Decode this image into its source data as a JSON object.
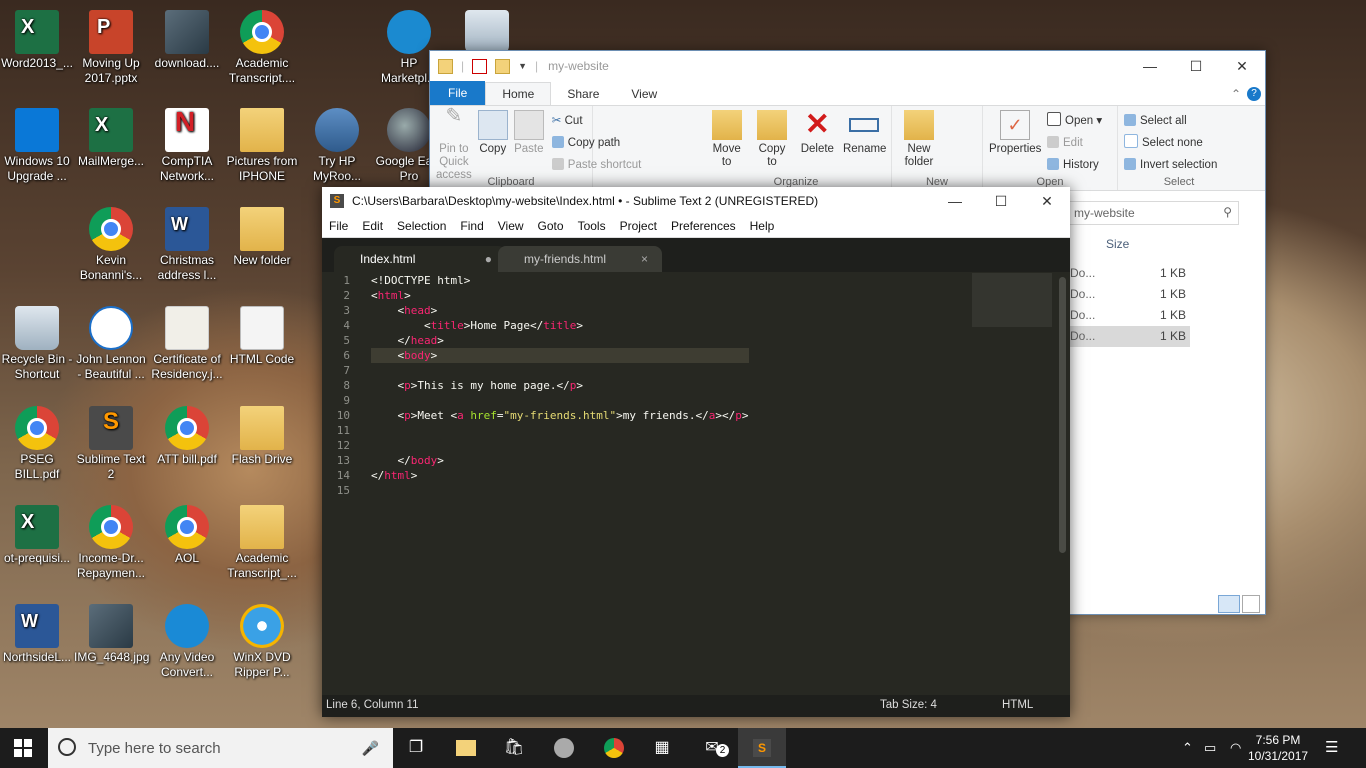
{
  "desktop": {
    "icons": [
      {
        "label": "Word2013_..."
      },
      {
        "label": "Moving Up 2017.pptx"
      },
      {
        "label": "download...."
      },
      {
        "label": "Academic Transcript...."
      },
      {
        "label": "HP Marketpl..."
      },
      {
        "label": "Windows 10 Upgrade ..."
      },
      {
        "label": "MailMerge..."
      },
      {
        "label": "CompTIA Network..."
      },
      {
        "label": "Pictures from IPHONE"
      },
      {
        "label": "Try HP MyRoo..."
      },
      {
        "label": "Google Ea... Pro"
      },
      {
        "label": "Kevin Bonanni's..."
      },
      {
        "label": "Christmas address l..."
      },
      {
        "label": "New folder"
      },
      {
        "label": "Recycle Bin - Shortcut"
      },
      {
        "label": "John Lennon - Beautiful ..."
      },
      {
        "label": "Certificate of Residency.j..."
      },
      {
        "label": "HTML Code"
      },
      {
        "label": "PSEG BILL.pdf"
      },
      {
        "label": "Sublime Text 2"
      },
      {
        "label": "ATT bill.pdf"
      },
      {
        "label": "Flash Drive"
      },
      {
        "label": "ot-prequisi..."
      },
      {
        "label": "Income-Dr... Repaymen..."
      },
      {
        "label": "AOL"
      },
      {
        "label": "Academic Transcript_..."
      },
      {
        "label": "NorthsideL..."
      },
      {
        "label": "IMG_4648.jpg"
      },
      {
        "label": "Any Video Convert..."
      },
      {
        "label": "WinX DVD Ripper P..."
      }
    ]
  },
  "explorer": {
    "title": "my-website",
    "tabs": [
      "File",
      "Home",
      "Share",
      "View"
    ],
    "ribbon": {
      "pin_label": "Pin to Quick access",
      "copy_label": "Copy",
      "paste_label": "Paste",
      "cut_label": "Cut",
      "copy_path_label": "Copy path",
      "paste_shortcut_label": "Paste shortcut",
      "clipboard_group": "Clipboard",
      "move_to_label": "Move to",
      "copy_to_label": "Copy to",
      "delete_label": "Delete",
      "rename_label": "Rename",
      "organize_group": "Organize",
      "new_folder_label": "New folder",
      "new_group": "New",
      "properties_label": "Properties",
      "open_label": "Open",
      "edit_label": "Edit",
      "history_label": "History",
      "open_group": "Open",
      "select_all_label": "Select all",
      "select_none_label": "Select none",
      "invert_selection_label": "Invert selection",
      "select_group": "Select"
    },
    "search_placeholder": "my-website",
    "column_size": "Size",
    "files": [
      {
        "name": "Do...",
        "size": "1 KB"
      },
      {
        "name": "Do...",
        "size": "1 KB"
      },
      {
        "name": "Do...",
        "size": "1 KB"
      },
      {
        "name": "Do...",
        "size": "1 KB"
      }
    ]
  },
  "sublime": {
    "title": "C:\\Users\\Barbara\\Desktop\\my-website\\Index.html • - Sublime Text 2 (UNREGISTERED)",
    "menu": [
      "File",
      "Edit",
      "Selection",
      "Find",
      "View",
      "Goto",
      "Tools",
      "Project",
      "Preferences",
      "Help"
    ],
    "tabs": [
      {
        "label": "Index.html",
        "marker": "●"
      },
      {
        "label": "my-friends.html",
        "marker": "×"
      }
    ],
    "line_numbers": [
      "1",
      "2",
      "3",
      "4",
      "5",
      "6",
      "7",
      "8",
      "9",
      "10",
      "11",
      "12",
      "13",
      "14",
      "15"
    ],
    "status": {
      "position": "Line 6, Column 11",
      "tab_size": "Tab Size: 4",
      "syntax": "HTML"
    }
  },
  "taskbar": {
    "search_placeholder": "Type here to search",
    "time": "7:56 PM",
    "date": "10/31/2017",
    "mail_badge": "2"
  }
}
